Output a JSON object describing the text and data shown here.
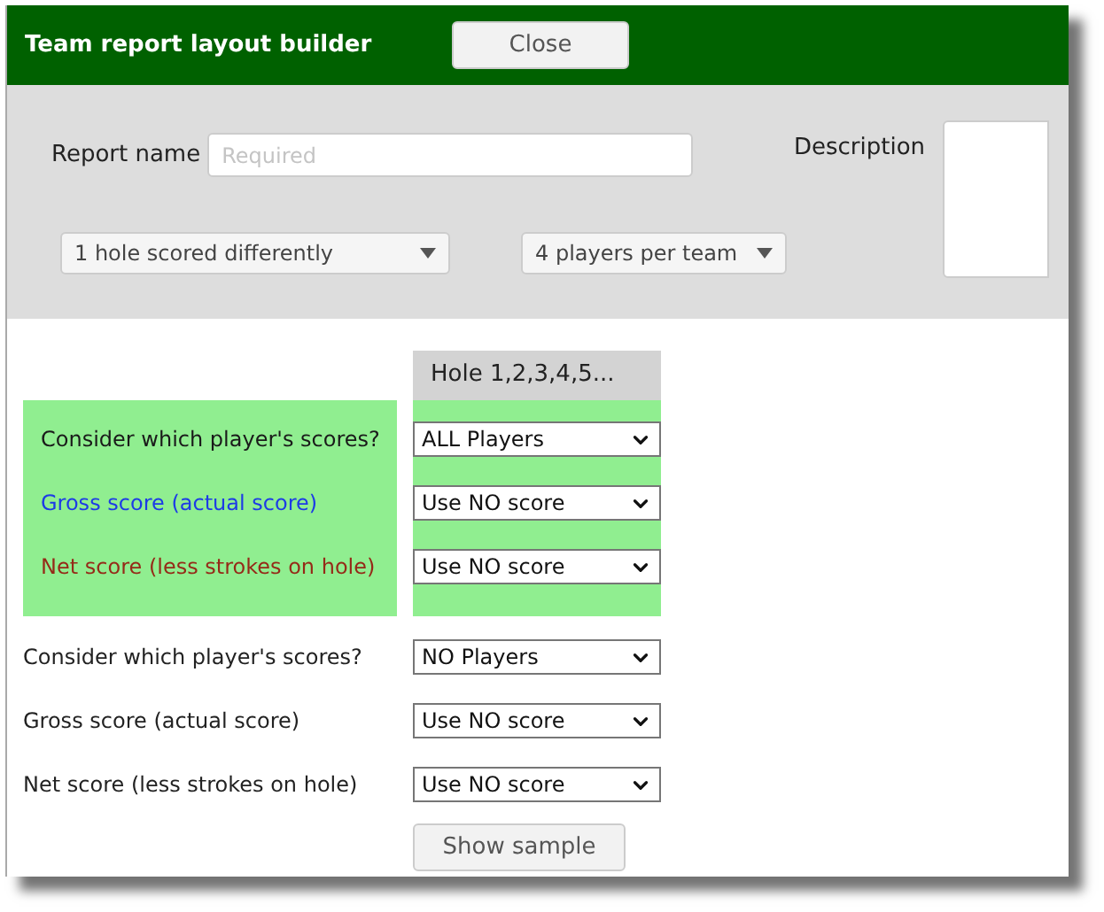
{
  "window": {
    "title": "Team report layout builder",
    "close_button": "Close"
  },
  "form": {
    "report_name": {
      "label": "Report name",
      "placeholder": "Required"
    },
    "description": {
      "label": "Description"
    },
    "dropdowns": [
      "1 hole scored differently",
      "4 players per team"
    ]
  },
  "column_header": "Hole 1,2,3,4,5...",
  "groups": [
    {
      "highlighted": true,
      "rows": [
        {
          "label": "Consider which player's scores?",
          "color": "#1a1a1a",
          "value": "ALL Players"
        },
        {
          "label": "Gross score (actual score)",
          "color": "#1d3be6",
          "value": "Use NO score"
        },
        {
          "label": "Net score (less strokes on hole)",
          "color": "#952a18",
          "value": "Use NO score"
        }
      ]
    },
    {
      "highlighted": false,
      "rows": [
        {
          "label": "Consider which player's scores?",
          "color": "#222222",
          "value": "NO Players"
        },
        {
          "label": "Gross score (actual score)",
          "color": "#222222",
          "value": "Use NO score"
        },
        {
          "label": "Net score (less strokes on hole)",
          "color": "#222222",
          "value": "Use NO score"
        }
      ]
    }
  ],
  "sample_button": "Show sample"
}
